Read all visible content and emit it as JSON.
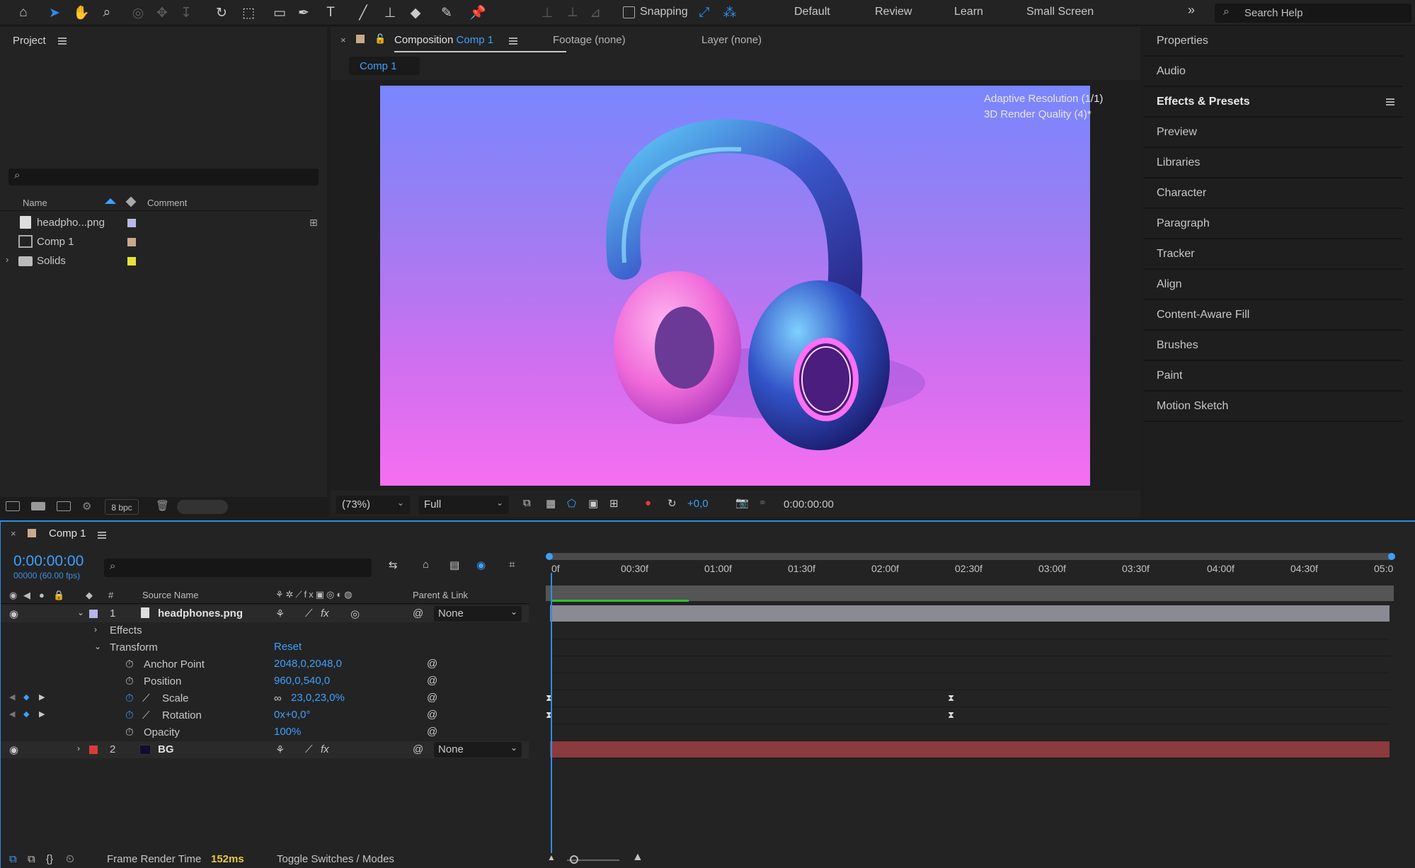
{
  "toolbar": {
    "snapping_label": "Snapping",
    "workspaces": [
      "Default",
      "Review",
      "Learn",
      "Small Screen"
    ],
    "search_placeholder": "Search Help"
  },
  "project": {
    "title": "Project",
    "columns": {
      "name": "Name",
      "comment": "Comment"
    },
    "items": [
      {
        "name": "headpho...png",
        "label_color": "#b9b6ea"
      },
      {
        "name": "Comp 1",
        "label_color": "#c9a98a"
      },
      {
        "name": "Solids",
        "label_color": "#e8e13c"
      }
    ],
    "bpc": "8 bpc"
  },
  "composition": {
    "tab_prefix": "Composition",
    "tab_name": "Comp 1",
    "footage_tab": "Footage (none)",
    "layer_tab": "Layer (none)",
    "comp_button": "Comp 1",
    "adaptive_line1": "Adaptive Resolution (1/1)",
    "adaptive_line2": "3D Render Quality (4)*",
    "zoom": "(73%)",
    "resolution": "Full",
    "exposure": "+0,0",
    "timecode": "0:00:00:00"
  },
  "right_panel": {
    "items": [
      "Properties",
      "Audio",
      "Effects & Presets",
      "Preview",
      "Libraries",
      "Character",
      "Paragraph",
      "Tracker",
      "Align",
      "Content-Aware Fill",
      "Brushes",
      "Paint",
      "Motion Sketch"
    ]
  },
  "timeline": {
    "tab_name": "Comp 1",
    "current_time": "0:00:00:00",
    "frame_info": "00000 (60.00 fps)",
    "columns": {
      "number": "#",
      "source": "Source Name",
      "parent": "Parent & Link"
    },
    "ruler_labels": [
      "0f",
      "00:30f",
      "01:00f",
      "01:30f",
      "02:00f",
      "02:30f",
      "03:00f",
      "03:30f",
      "04:00f",
      "04:30f",
      "05:0"
    ],
    "layers": [
      {
        "num": "1",
        "name": "headphones.png",
        "parent": "None",
        "label_color": "#b9b6ea"
      },
      {
        "num": "2",
        "name": "BG",
        "parent": "None",
        "label_color": "#d93b3b"
      }
    ],
    "groups": {
      "effects": "Effects",
      "transform": "Transform",
      "reset": "Reset"
    },
    "props": [
      {
        "name": "Anchor Point",
        "value": "2048,0,2048,0"
      },
      {
        "name": "Position",
        "value": "960,0,540,0"
      },
      {
        "name": "Scale",
        "value": "23,0,23,0%"
      },
      {
        "name": "Rotation",
        "value": "0x+0,0°"
      },
      {
        "name": "Opacity",
        "value": "100%"
      }
    ],
    "footer": {
      "render_label": "Frame Render Time",
      "render_value": "152ms",
      "toggle": "Toggle Switches / Modes"
    }
  },
  "colors": {
    "accent": "#2d8ceb",
    "bg_track": "#8b3a3e",
    "layer1_track": "#8a8a93"
  }
}
